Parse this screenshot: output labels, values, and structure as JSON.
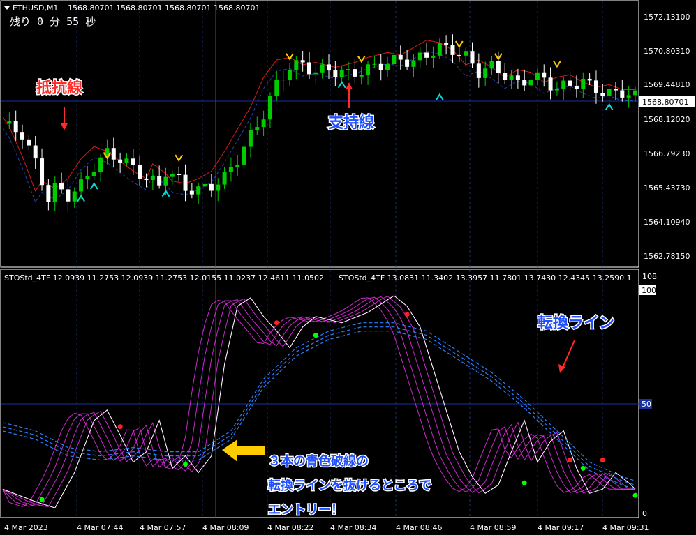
{
  "header": {
    "symbol": "ETHUSD,M1",
    "ohlc": [
      "1568.80701",
      "1568.80701",
      "1568.80701",
      "1568.80701"
    ],
    "timer": "残り 0 分 55 秒"
  },
  "price_axis": {
    "labels": [
      "1572.13100",
      "1570.80310",
      "1569.44810",
      "1568.12020",
      "1566.79230",
      "1565.43730",
      "1564.10940",
      "1562.78150"
    ],
    "current_price": "1568.80701"
  },
  "osc_header": {
    "left": "STOStd_4TF 12.0939 11.2753 12.0939 11.2753 12.0155 11.0237 12.4611 11.0502",
    "right": "STOStd_4TF 13.0831 11.3402 13.3957 11.7801 13.7430 12.4345 13.2590 1"
  },
  "osc_axis": {
    "top": "108",
    "level_100": "100",
    "level_50": "50",
    "level_0": "0"
  },
  "time_axis": [
    "4 Mar 2023",
    "4 Mar 07:44",
    "4 Mar 07:57",
    "4 Mar 08:09",
    "4 Mar 08:22",
    "4 Mar 08:34",
    "4 Mar 08:46",
    "4 Mar 08:59",
    "4 Mar 09:17",
    "4 Mar 09:31"
  ],
  "annotations": {
    "resistance": "抵抗線",
    "support": "支持線",
    "turning_line": "転換ライン",
    "entry_line1": "３本の青色破線の",
    "entry_line2": "転換ラインを抜けるところで",
    "entry_line3": "エントリー！"
  },
  "colors": {
    "background": "#000000",
    "bull_candle": "#00cc00",
    "bear_candle": "#ffffff",
    "resistance_red": "#ff2020",
    "support_blue": "#3060ff",
    "stoch_magenta": "#ff33ff",
    "annotation_red": "#ff2a2a",
    "annotation_blue": "#1f4fff",
    "arrow_yellow": "#ffcc00",
    "arrow_cyan": "#00e0e0"
  },
  "chart_data": {
    "type": "candlestick",
    "symbol": "ETHUSD",
    "timeframe": "M1",
    "ylim": [
      1562.4,
      1572.7
    ],
    "close_path": [
      [
        0,
        1568.2
      ],
      [
        3,
        1567.8
      ],
      [
        5,
        1566.6
      ],
      [
        7,
        1565.2
      ],
      [
        8,
        1565.6
      ],
      [
        10,
        1565.3
      ],
      [
        12,
        1565.7
      ],
      [
        14,
        1566.5
      ],
      [
        16,
        1567.0
      ],
      [
        18,
        1566.8
      ],
      [
        20,
        1566.4
      ],
      [
        22,
        1566.0
      ],
      [
        24,
        1565.7
      ],
      [
        25,
        1566.3
      ],
      [
        27,
        1565.9
      ],
      [
        28,
        1565.6
      ],
      [
        30,
        1565.5
      ],
      [
        32,
        1565.7
      ],
      [
        34,
        1566.0
      ],
      [
        36,
        1566.8
      ],
      [
        38,
        1567.7
      ],
      [
        40,
        1568.6
      ],
      [
        42,
        1569.8
      ],
      [
        44,
        1570.5
      ],
      [
        46,
        1570.6
      ],
      [
        48,
        1570.3
      ],
      [
        50,
        1570.4
      ],
      [
        53,
        1570.2
      ],
      [
        56,
        1570.4
      ],
      [
        58,
        1570.6
      ],
      [
        61,
        1570.8
      ],
      [
        63,
        1570.7
      ],
      [
        65,
        1571.0
      ],
      [
        67,
        1571.3
      ],
      [
        69,
        1571.2
      ],
      [
        71,
        1570.9
      ],
      [
        73,
        1570.3
      ],
      [
        75,
        1570.5
      ],
      [
        77,
        1570.2
      ],
      [
        79,
        1569.8
      ],
      [
        81,
        1570.1
      ],
      [
        83,
        1570.0
      ],
      [
        85,
        1569.6
      ],
      [
        87,
        1569.8
      ],
      [
        89,
        1569.9
      ],
      [
        91,
        1569.6
      ],
      [
        93,
        1569.4
      ],
      [
        95,
        1569.5
      ],
      [
        97,
        1569.3
      ]
    ],
    "oscillator": {
      "ylim": [
        0,
        108
      ],
      "levels": [
        0,
        50,
        100
      ],
      "fast_path": [
        [
          0,
          12
        ],
        [
          5,
          6
        ],
        [
          8,
          3
        ],
        [
          11,
          20
        ],
        [
          14,
          45
        ],
        [
          16,
          50
        ],
        [
          18,
          38
        ],
        [
          20,
          25
        ],
        [
          22,
          30
        ],
        [
          24,
          45
        ],
        [
          26,
          22
        ],
        [
          28,
          28
        ],
        [
          30,
          20
        ],
        [
          32,
          28
        ],
        [
          34,
          72
        ],
        [
          36,
          100
        ],
        [
          38,
          104
        ],
        [
          40,
          95
        ],
        [
          42,
          88
        ],
        [
          44,
          80
        ],
        [
          46,
          90
        ],
        [
          48,
          95
        ],
        [
          52,
          92
        ],
        [
          56,
          97
        ],
        [
          60,
          105
        ],
        [
          62,
          100
        ],
        [
          64,
          90
        ],
        [
          66,
          70
        ],
        [
          68,
          50
        ],
        [
          70,
          30
        ],
        [
          72,
          18
        ],
        [
          74,
          10
        ],
        [
          76,
          14
        ],
        [
          78,
          30
        ],
        [
          80,
          45
        ],
        [
          82,
          25
        ],
        [
          84,
          35
        ],
        [
          86,
          40
        ],
        [
          88,
          22
        ],
        [
          90,
          10
        ],
        [
          92,
          12
        ],
        [
          94,
          20
        ],
        [
          96,
          15
        ],
        [
          97,
          12
        ]
      ],
      "turning_line_path": [
        [
          0,
          44
        ],
        [
          5,
          40
        ],
        [
          10,
          32
        ],
        [
          15,
          30
        ],
        [
          20,
          32
        ],
        [
          25,
          30
        ],
        [
          30,
          30
        ],
        [
          35,
          40
        ],
        [
          40,
          65
        ],
        [
          45,
          80
        ],
        [
          50,
          88
        ],
        [
          55,
          92
        ],
        [
          60,
          92
        ],
        [
          65,
          88
        ],
        [
          70,
          78
        ],
        [
          75,
          68
        ],
        [
          80,
          55
        ],
        [
          85,
          40
        ],
        [
          90,
          25
        ],
        [
          95,
          18
        ],
        [
          97,
          16
        ]
      ]
    }
  }
}
